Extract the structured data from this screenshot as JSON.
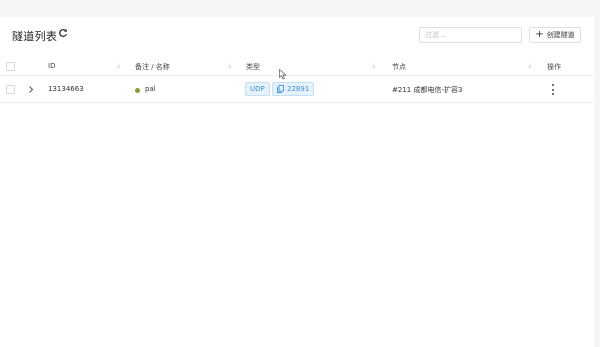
{
  "header": {
    "title": "隧道列表",
    "filter_placeholder": "过滤...",
    "create_button": "创建隧道"
  },
  "table": {
    "columns": [
      "ID",
      "备注 / 名称",
      "类型",
      "节点",
      "操作"
    ],
    "rows": [
      {
        "id": "13134663",
        "name": "pal",
        "status_color": "#8a9a32",
        "protocol": "UDP",
        "port": "22891",
        "node": "#211 成都电信-扩容3"
      }
    ]
  }
}
